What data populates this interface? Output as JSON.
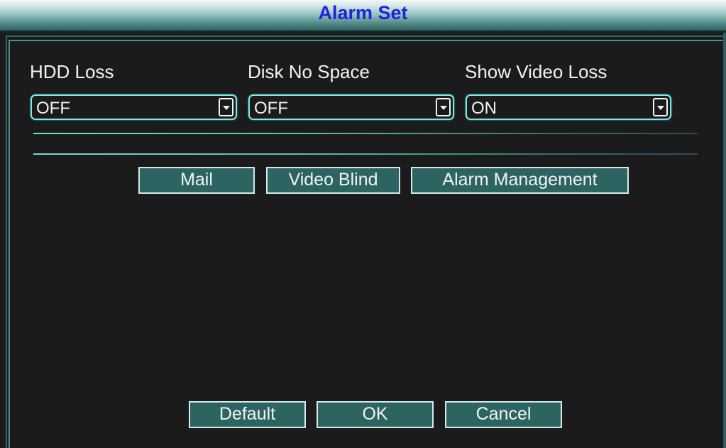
{
  "window": {
    "title": "Alarm Set"
  },
  "fields": [
    {
      "label": "HDD Loss",
      "value": "OFF"
    },
    {
      "label": "Disk No Space",
      "value": "OFF"
    },
    {
      "label": "Show Video Loss",
      "value": "ON"
    }
  ],
  "subbuttons": {
    "mail": "Mail",
    "video_blind": "Video Blind",
    "alarm_management": "Alarm Management"
  },
  "footer": {
    "default": "Default",
    "ok": "OK",
    "cancel": "Cancel"
  },
  "colors": {
    "title_text": "#1e22d8",
    "background": "#1b1b1b",
    "accent": "#7fe8ea",
    "button_fill": "#2c6462"
  }
}
